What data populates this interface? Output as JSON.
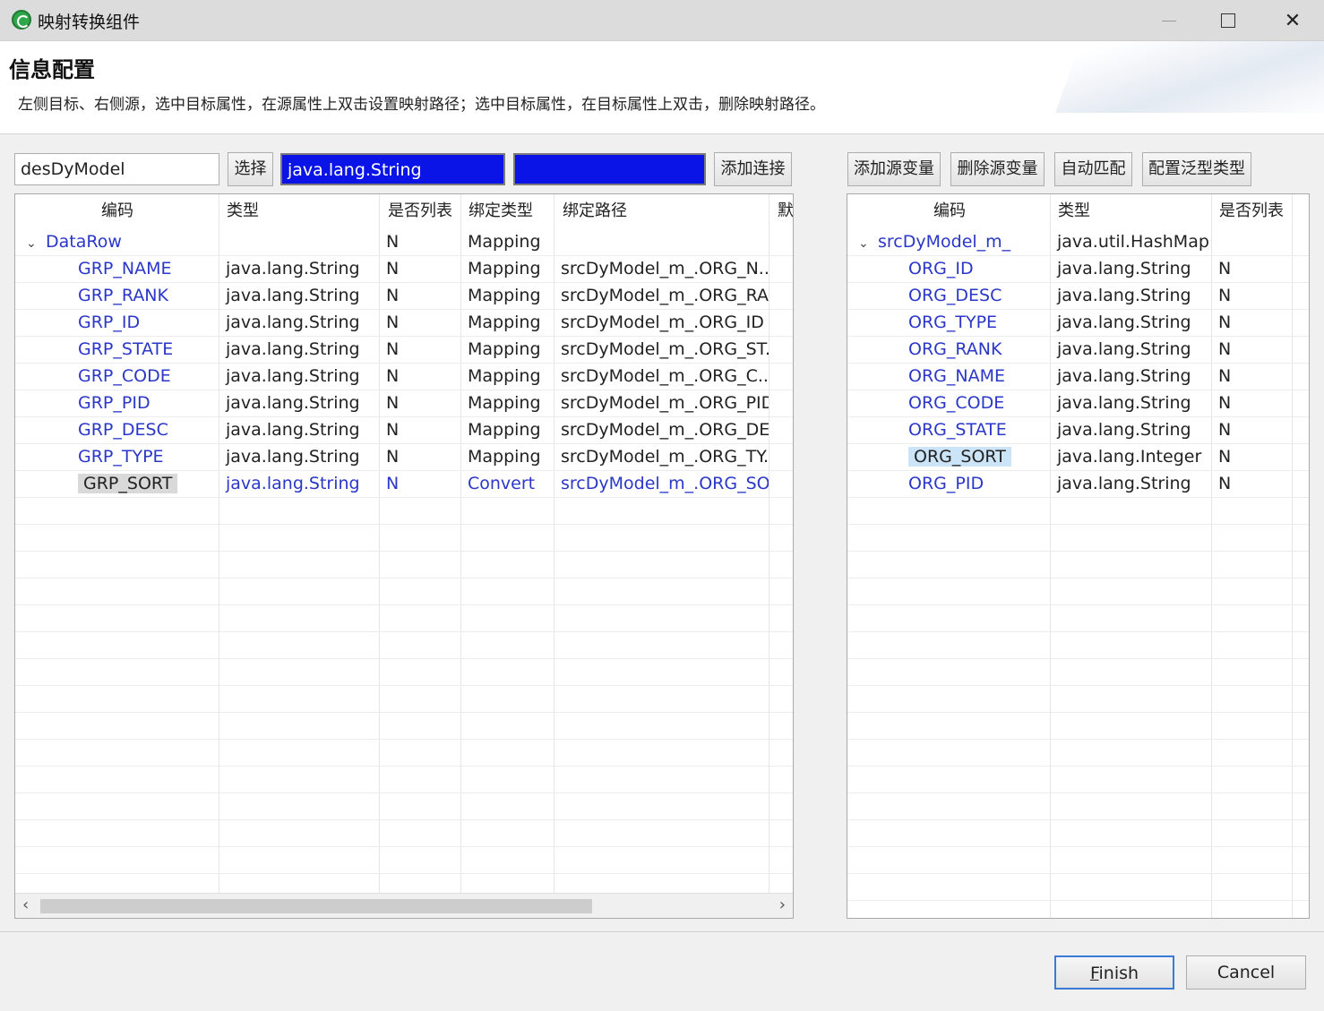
{
  "window": {
    "title": "映射转换组件"
  },
  "header": {
    "title": "信息配置",
    "description": "左侧目标、右侧源，选中目标属性，在源属性上双击设置映射路径；选中目标属性，在目标属性上双击，删除映射路径。"
  },
  "left_toolbar": {
    "model_input": "desDyModel",
    "select_button": "选择",
    "type_input": "java.lang.String",
    "extra_input": "",
    "add_link_button": "添加连接"
  },
  "right_toolbar": {
    "add_source_var": "添加源变量",
    "delete_source_var": "删除源变量",
    "auto_match": "自动匹配",
    "config_generic": "配置泛型类型"
  },
  "left_table": {
    "columns": [
      "编码",
      "类型",
      "是否列表",
      "绑定类型",
      "绑定路径",
      "默"
    ],
    "root": {
      "code": "DataRow",
      "type": "",
      "is_list": "N",
      "bind_type": "Mapping",
      "bind_path": ""
    },
    "rows": [
      {
        "code": "GRP_NAME",
        "type": "java.lang.String",
        "is_list": "N",
        "bind_type": "Mapping",
        "bind_path": "srcDyModel_m_.ORG_N..."
      },
      {
        "code": "GRP_RANK",
        "type": "java.lang.String",
        "is_list": "N",
        "bind_type": "Mapping",
        "bind_path": "srcDyModel_m_.ORG_RA..."
      },
      {
        "code": "GRP_ID",
        "type": "java.lang.String",
        "is_list": "N",
        "bind_type": "Mapping",
        "bind_path": "srcDyModel_m_.ORG_ID"
      },
      {
        "code": "GRP_STATE",
        "type": "java.lang.String",
        "is_list": "N",
        "bind_type": "Mapping",
        "bind_path": "srcDyModel_m_.ORG_ST..."
      },
      {
        "code": "GRP_CODE",
        "type": "java.lang.String",
        "is_list": "N",
        "bind_type": "Mapping",
        "bind_path": "srcDyModel_m_.ORG_C..."
      },
      {
        "code": "GRP_PID",
        "type": "java.lang.String",
        "is_list": "N",
        "bind_type": "Mapping",
        "bind_path": "srcDyModel_m_.ORG_PID"
      },
      {
        "code": "GRP_DESC",
        "type": "java.lang.String",
        "is_list": "N",
        "bind_type": "Mapping",
        "bind_path": "srcDyModel_m_.ORG_DE..."
      },
      {
        "code": "GRP_TYPE",
        "type": "java.lang.String",
        "is_list": "N",
        "bind_type": "Mapping",
        "bind_path": "srcDyModel_m_.ORG_TY..."
      },
      {
        "code": "GRP_SORT",
        "type": "java.lang.String",
        "is_list": "N",
        "bind_type": "Convert",
        "bind_path": "srcDyModel_m_.ORG_SO..."
      }
    ]
  },
  "right_table": {
    "columns": [
      "编码",
      "类型",
      "是否列表"
    ],
    "root": {
      "code": "srcDyModel_m_",
      "type": "java.util.HashMap",
      "is_list": ""
    },
    "rows": [
      {
        "code": "ORG_ID",
        "type": "java.lang.String",
        "is_list": "N"
      },
      {
        "code": "ORG_DESC",
        "type": "java.lang.String",
        "is_list": "N"
      },
      {
        "code": "ORG_TYPE",
        "type": "java.lang.String",
        "is_list": "N"
      },
      {
        "code": "ORG_RANK",
        "type": "java.lang.String",
        "is_list": "N"
      },
      {
        "code": "ORG_NAME",
        "type": "java.lang.String",
        "is_list": "N"
      },
      {
        "code": "ORG_CODE",
        "type": "java.lang.String",
        "is_list": "N"
      },
      {
        "code": "ORG_STATE",
        "type": "java.lang.String",
        "is_list": "N"
      },
      {
        "code": "ORG_SORT",
        "type": "java.lang.Integer",
        "is_list": "N"
      },
      {
        "code": "ORG_PID",
        "type": "java.lang.String",
        "is_list": "N"
      }
    ]
  },
  "footer": {
    "finish_button": "Finish",
    "cancel_button": "Cancel"
  },
  "colors": {
    "link_blue": "#2a37c8",
    "selection_blue": "#0a14e6",
    "grey_highlight": "#d9d9d9",
    "light_blue_highlight": "#cce4f7"
  }
}
